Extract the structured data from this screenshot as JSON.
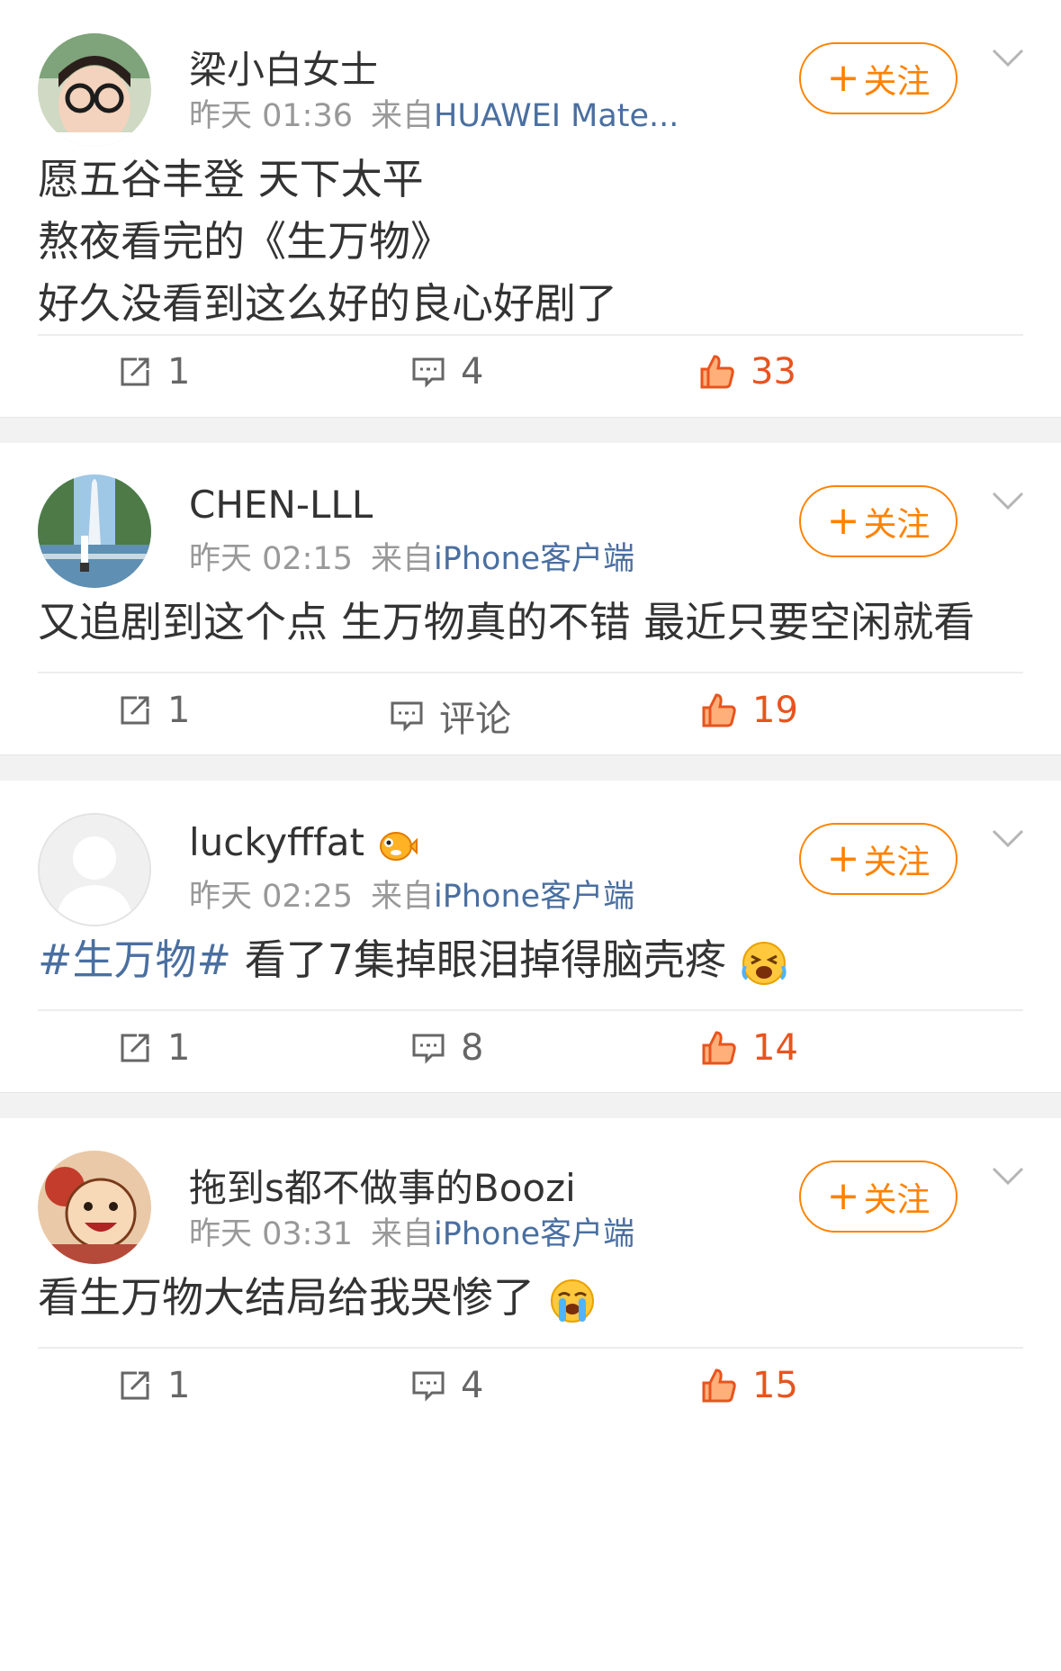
{
  "follow_label": "关注",
  "posts": [
    {
      "username": "梁小白女士",
      "time": "昨天 01:36",
      "source_prefix": "来自",
      "source": "HUAWEI Mate...",
      "content_lines": [
        "愿五谷丰登 天下太平",
        "熬夜看完的《生万物》",
        "好久没看到这么好的良心好剧了"
      ],
      "reposts": "1",
      "comments": "4",
      "likes": "33"
    },
    {
      "username": "CHEN-LLL",
      "time": "昨天 02:15",
      "source_prefix": "来自",
      "source": "iPhone客户端",
      "content_lines": [
        "又追剧到这个点 生万物真的不错 最近只要空闲就看"
      ],
      "reposts": "1",
      "comments": "评论",
      "likes": "19"
    },
    {
      "username": "luckyfffat",
      "time": "昨天 02:25",
      "source_prefix": "来自",
      "source": "iPhone客户端",
      "hashtag": "#生万物#",
      "content_text": " 看了7集掉眼泪掉得脑壳疼",
      "reposts": "1",
      "comments": "8",
      "likes": "14"
    },
    {
      "username": "拖到s都不做事的Boozi",
      "time": "昨天 03:31",
      "source_prefix": "来自",
      "source": "iPhone客户端",
      "content_text": "看生万物大结局给我哭惨了",
      "reposts": "1",
      "comments": "4",
      "likes": "15"
    }
  ],
  "icons": {
    "repost": "repost-icon",
    "comment": "comment-icon",
    "like": "thumbs-up-icon",
    "menu": "chevron-down-icon"
  },
  "colors": {
    "follow_accent": "#ff8200",
    "like_accent": "#e8541e",
    "link_blue": "#4a6fa0",
    "separator": "#f2f2f2"
  }
}
